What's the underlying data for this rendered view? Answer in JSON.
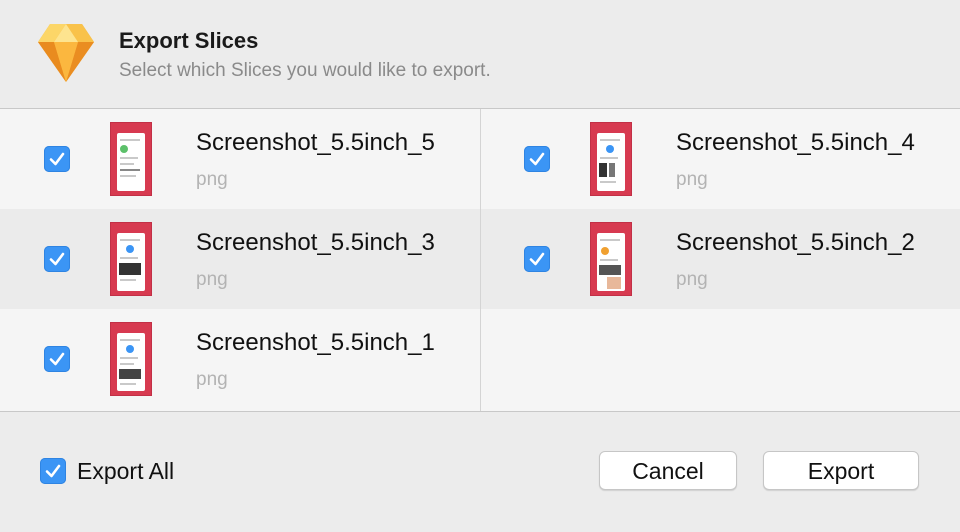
{
  "dialog": {
    "title": "Export Slices",
    "subtitle": "Select which Slices you would like to export.",
    "app_icon": "sketch-diamond-icon"
  },
  "slices": [
    {
      "name": "Screenshot_5.5inch_5",
      "type": "png",
      "checked": true
    },
    {
      "name": "Screenshot_5.5inch_4",
      "type": "png",
      "checked": true
    },
    {
      "name": "Screenshot_5.5inch_3",
      "type": "png",
      "checked": true
    },
    {
      "name": "Screenshot_5.5inch_2",
      "type": "png",
      "checked": true
    },
    {
      "name": "Screenshot_5.5inch_1",
      "type": "png",
      "checked": true
    }
  ],
  "footer": {
    "export_all_label": "Export All",
    "export_all_checked": true,
    "cancel_label": "Cancel",
    "export_label": "Export"
  },
  "colors": {
    "accent": "#3b95f5",
    "thumbnail_bg": "#d73a50",
    "window_bg": "#ececec"
  }
}
